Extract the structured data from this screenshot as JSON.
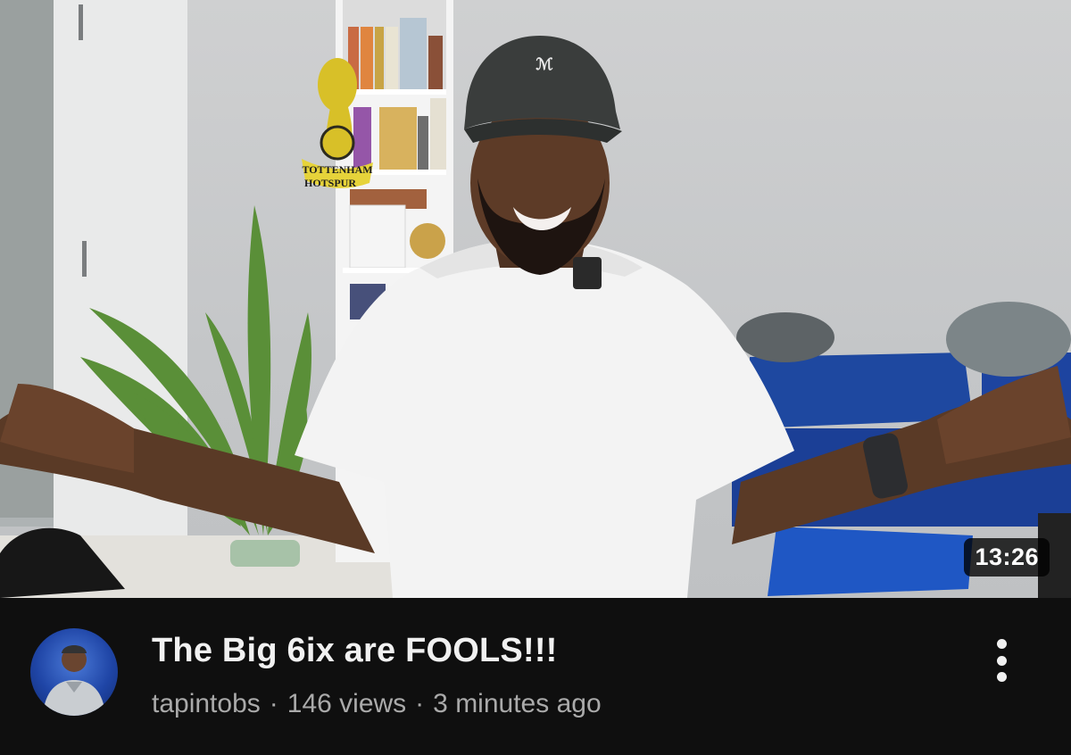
{
  "video": {
    "duration": "13:26",
    "title": "The Big 6ix are FOOLS!!!",
    "channel": "tapintobs",
    "views": "146 views",
    "age": "3 minutes ago",
    "separator": "·"
  },
  "thumbnail": {
    "crest_text_line1": "TOTTENHAM",
    "crest_text_line2": "HOTSPUR"
  },
  "icons": {
    "more": "more-vert-icon"
  }
}
